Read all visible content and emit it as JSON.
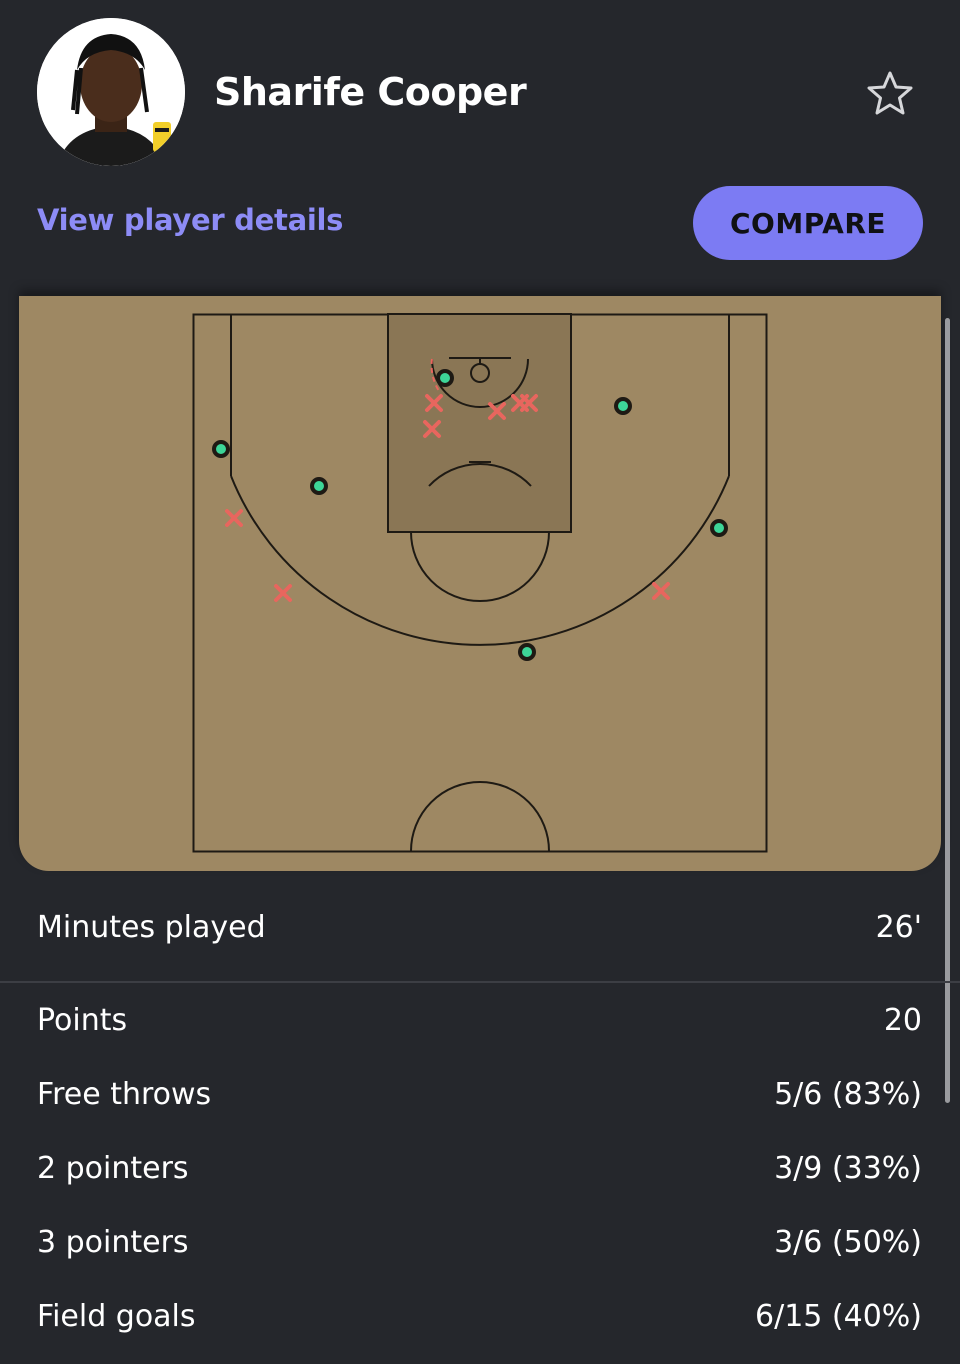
{
  "player": {
    "name": "Sharife Cooper",
    "details_link": "View player details",
    "compare_label": "COMPARE",
    "favorite_icon": "star-outline-icon"
  },
  "shot_chart": {
    "made_icon": "circle-marker",
    "missed_icon": "x-marker",
    "colors": {
      "made": "#3dd598",
      "missed": "#e8665e",
      "court": "#9e8863",
      "paint": "#8a7655"
    }
  },
  "stats": {
    "minutes": {
      "label": "Minutes played",
      "value": "26'"
    },
    "rows": [
      {
        "label": "Points",
        "value": "20"
      },
      {
        "label": "Free throws",
        "value": "5/6 (83%)"
      },
      {
        "label": "2 pointers",
        "value": "3/9 (33%)"
      },
      {
        "label": "3 pointers",
        "value": "3/6 (50%)"
      },
      {
        "label": "Field goals",
        "value": "6/15 (40%)"
      }
    ]
  },
  "colors": {
    "background": "#25272c",
    "accent": "#7c7bf3",
    "link": "#8d8cf6"
  }
}
